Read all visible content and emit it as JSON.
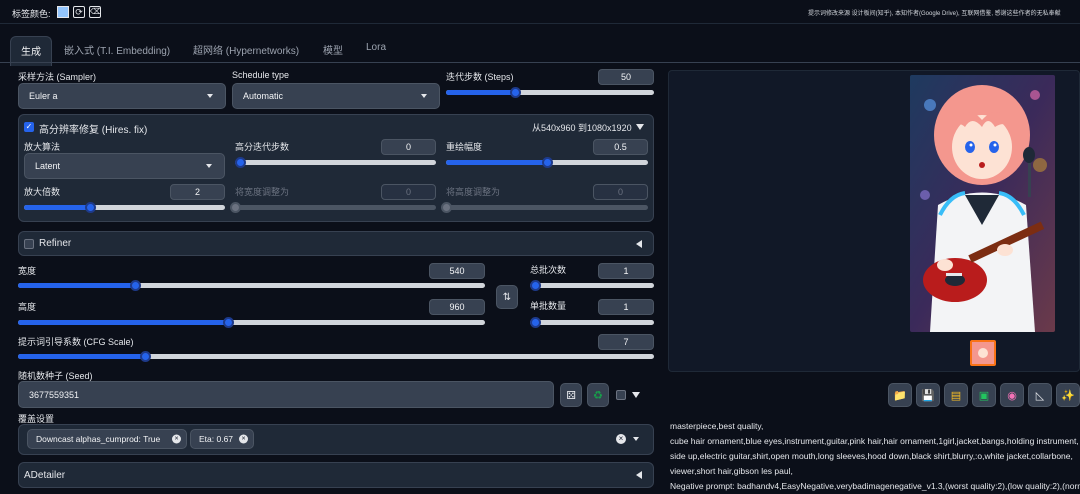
{
  "topbar": {
    "tag_color_label": "标签颜色:",
    "notice": "提示词修改来源 设计板间(知乎), 本知作者(Google Drive), 互联网借鉴, 感谢这些作者的无私奉献"
  },
  "tabs": [
    "生成",
    "嵌入式 (T.I. Embedding)",
    "超网络 (Hypernetworks)",
    "模型",
    "Lora"
  ],
  "sampler": {
    "label": "采样方法 (Sampler)",
    "value": "Euler a"
  },
  "schedule": {
    "label": "Schedule type",
    "value": "Automatic"
  },
  "steps": {
    "label": "迭代步数 (Steps)",
    "value": "50",
    "fraction": 0.33
  },
  "hires": {
    "label": "高分辨率修复 (Hires. fix)",
    "resolution": "从540x960 到1080x1920",
    "upscaler_label": "放大算法",
    "upscaler_value": "Latent",
    "hires_steps_label": "高分迭代步数",
    "hires_steps_value": "0",
    "hires_steps_fraction": 0.0,
    "denoise_label": "重绘幅度",
    "denoise_value": "0.5",
    "denoise_fraction": 0.5,
    "scale_label": "放大倍数",
    "scale_value": "2",
    "scale_fraction": 0.33,
    "resize_w_label": "将宽度调整为",
    "resize_w_value": "0",
    "resize_h_label": "将高度调整为",
    "resize_h_value": "0"
  },
  "refiner": {
    "label": "Refiner"
  },
  "width": {
    "label": "宽度",
    "value": "540",
    "fraction": 0.25
  },
  "height": {
    "label": "高度",
    "value": "960",
    "fraction": 0.45
  },
  "batch_count": {
    "label": "总批次数",
    "value": "1",
    "fraction": 0.0
  },
  "batch_size": {
    "label": "单批数量",
    "value": "1",
    "fraction": 0.0
  },
  "cfg": {
    "label": "提示词引导系数 (CFG Scale)",
    "value": "7",
    "fraction": 0.2
  },
  "seed": {
    "label": "随机数种子 (Seed)",
    "value": "3677559351"
  },
  "override": {
    "label": "覆盖设置",
    "chips": [
      "Downcast alphas_cumprod: True",
      "Eta: 0.67"
    ]
  },
  "adetailer": {
    "label": "ADetailer"
  },
  "output": {
    "prompt_lines": [
      "masterpiece,best quality,",
      "cube hair ornament,blue eyes,instrument,guitar,pink hair,hair ornament,1girl,jacket,bangs,holding instrument,",
      "side up,electric guitar,shirt,open mouth,long sleeves,hood down,black shirt,blurry,:o,white jacket,collarbone,",
      "viewer,short hair,gibson les paul,",
      "Negative prompt: badhandv4,EasyNegative,verybadimagenegative_v1.3,(worst quality:2),(low quality:2),(normal"
    ]
  },
  "colors": {
    "accent": "#2563eb",
    "bg": "#0b0f19",
    "panel": "#1f2937",
    "green": "#16a34a"
  }
}
